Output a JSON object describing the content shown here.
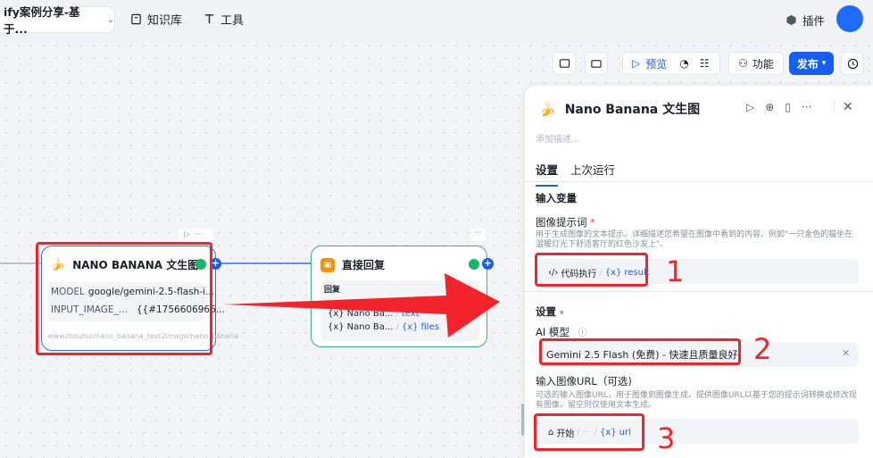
{
  "topbar": {
    "app_name": "ify案例分享-基于...",
    "nav_knowledge": "知识库",
    "nav_tools": "工具",
    "plugin": "插件"
  },
  "toolbar": {
    "preview": "预览",
    "features": "功能",
    "publish": "发布"
  },
  "node1": {
    "title": "NANO BANANA 文生图",
    "model_key": "MODEL",
    "model_val": "google/gemini-2.5-flash-i...",
    "image_key": "INPUT_IMAGE_...",
    "image_val": "{{#1756606966...",
    "footer": "wwwzhouhui/nano_banana_text2image/nano_banana"
  },
  "node2": {
    "title": "直接回复",
    "reply_label": "回复",
    "row1_src": "Nano Ba...",
    "row1_var": "text",
    "row2_src": "Nano Ba...",
    "row2_var": "files"
  },
  "panel": {
    "title": "Nano Banana 文生图",
    "desc_placeholder": "添加描述...",
    "tabs": [
      "设置",
      "上次运行"
    ],
    "input_vars": "输入变量",
    "prompt_label": "图像提示词",
    "prompt_help": "用于生成图像的文本提示。详细描述您希望在图像中看到的内容。例如\"一只金色的猫坐在温暖灯光下舒适客厅的红色沙发上\"。",
    "prompt_chip_src": "代码执行",
    "prompt_chip_var": "result",
    "settings": "设置",
    "model_label": "AI 模型",
    "model_value": "Gemini 2.5 Flash (免费) - 快速且质量良好",
    "url_label": "输入图像URL（可选)",
    "url_help": "可选的输入图像URL，用于图像到图像生成。提供图像URL以基于您的提示词转换或修改现有图像。留空则仅使用文本生成。",
    "url_chip_src": "开始",
    "url_chip_var": "url"
  },
  "annotations": [
    "1",
    "2",
    "3"
  ],
  "colors": {
    "accent": "#155eef",
    "success": "#12b76a",
    "annotation": "#f2232a"
  }
}
